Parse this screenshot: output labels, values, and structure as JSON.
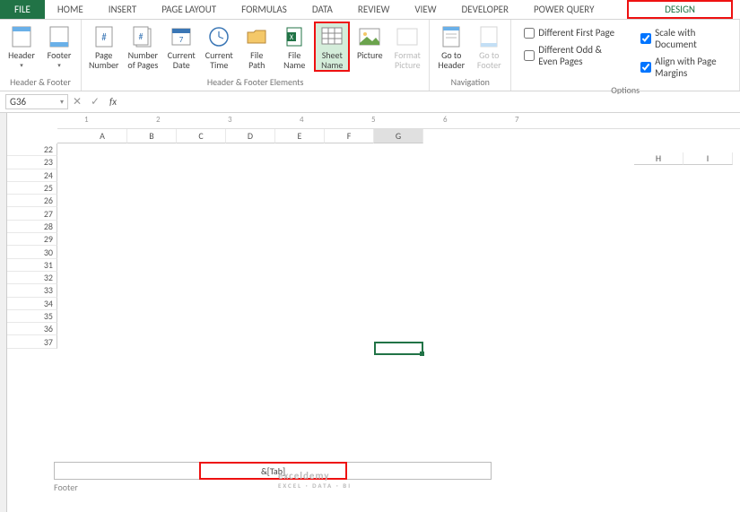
{
  "tabs": {
    "file": "FILE",
    "home": "HOME",
    "insert": "INSERT",
    "page_layout": "PAGE LAYOUT",
    "formulas": "FORMULAS",
    "data": "DATA",
    "review": "REVIEW",
    "view": "VIEW",
    "developer": "DEVELOPER",
    "power_query": "POWER QUERY",
    "design": "DESIGN"
  },
  "ribbon": {
    "hf": {
      "header": "Header",
      "footer": "Footer",
      "label": "Header & Footer"
    },
    "elements": {
      "page_number": "Page\nNumber",
      "num_pages": "Number\nof Pages",
      "cur_date": "Current\nDate",
      "cur_time": "Current\nTime",
      "file_path": "File\nPath",
      "file_name": "File\nName",
      "sheet_name": "Sheet\nName",
      "picture": "Picture",
      "fmt_picture": "Format\nPicture",
      "label": "Header & Footer Elements"
    },
    "nav": {
      "goto_header": "Go to\nHeader",
      "goto_footer": "Go to\nFooter",
      "label": "Navigation"
    },
    "options": {
      "diff_first": "Different First Page",
      "diff_odd": "Different Odd & Even Pages",
      "scale": "Scale with Document",
      "align": "Align with Page Margins",
      "label": "Options"
    }
  },
  "formula_bar": {
    "namebox": "G36",
    "fx": "fx"
  },
  "ruler": [
    "1",
    "2",
    "3",
    "4",
    "5",
    "6",
    "7"
  ],
  "cols": [
    "A",
    "B",
    "C",
    "D",
    "E",
    "F",
    "G"
  ],
  "cols_right": [
    "H",
    "I"
  ],
  "rows": [
    "22",
    "23",
    "24",
    "25",
    "26",
    "27",
    "28",
    "29",
    "30",
    "31",
    "32",
    "33",
    "34",
    "35",
    "36",
    "37"
  ],
  "footer": {
    "center_text": "&[Tab]",
    "label": "Footer"
  },
  "watermark": {
    "main": "exceldemy",
    "sub": "EXCEL · DATA · BI"
  },
  "selected_cell": {
    "col": "G",
    "row": "36"
  }
}
